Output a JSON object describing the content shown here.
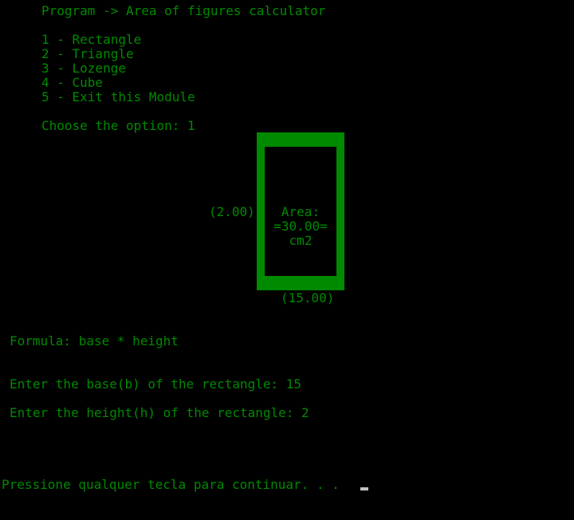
{
  "header": {
    "program_title": "Program -> Area of figures calculator"
  },
  "menu": {
    "options": [
      "1 - Rectangle",
      "2 - Triangle",
      "3 - Lozenge",
      "4 - Cube",
      "5 - Exit this Module"
    ],
    "choose_prompt": "Choose the option: 1"
  },
  "figure": {
    "height_label": "(2.00)",
    "base_label": "(15.00)",
    "area_lines": [
      "Area:",
      "=30.00=",
      "cm2"
    ]
  },
  "formula": {
    "text": "Formula: base * height"
  },
  "inputs": {
    "base_prompt": "Enter the base(b) of the rectangle: 15",
    "height_prompt": "Enter the height(h) of the rectangle: 2"
  },
  "footer": {
    "continue_prompt": "Pressione qualquer tecla para continuar. . ."
  },
  "colors": {
    "text": "#008a00",
    "background": "#000000",
    "cursor": "#c0c0c0"
  }
}
